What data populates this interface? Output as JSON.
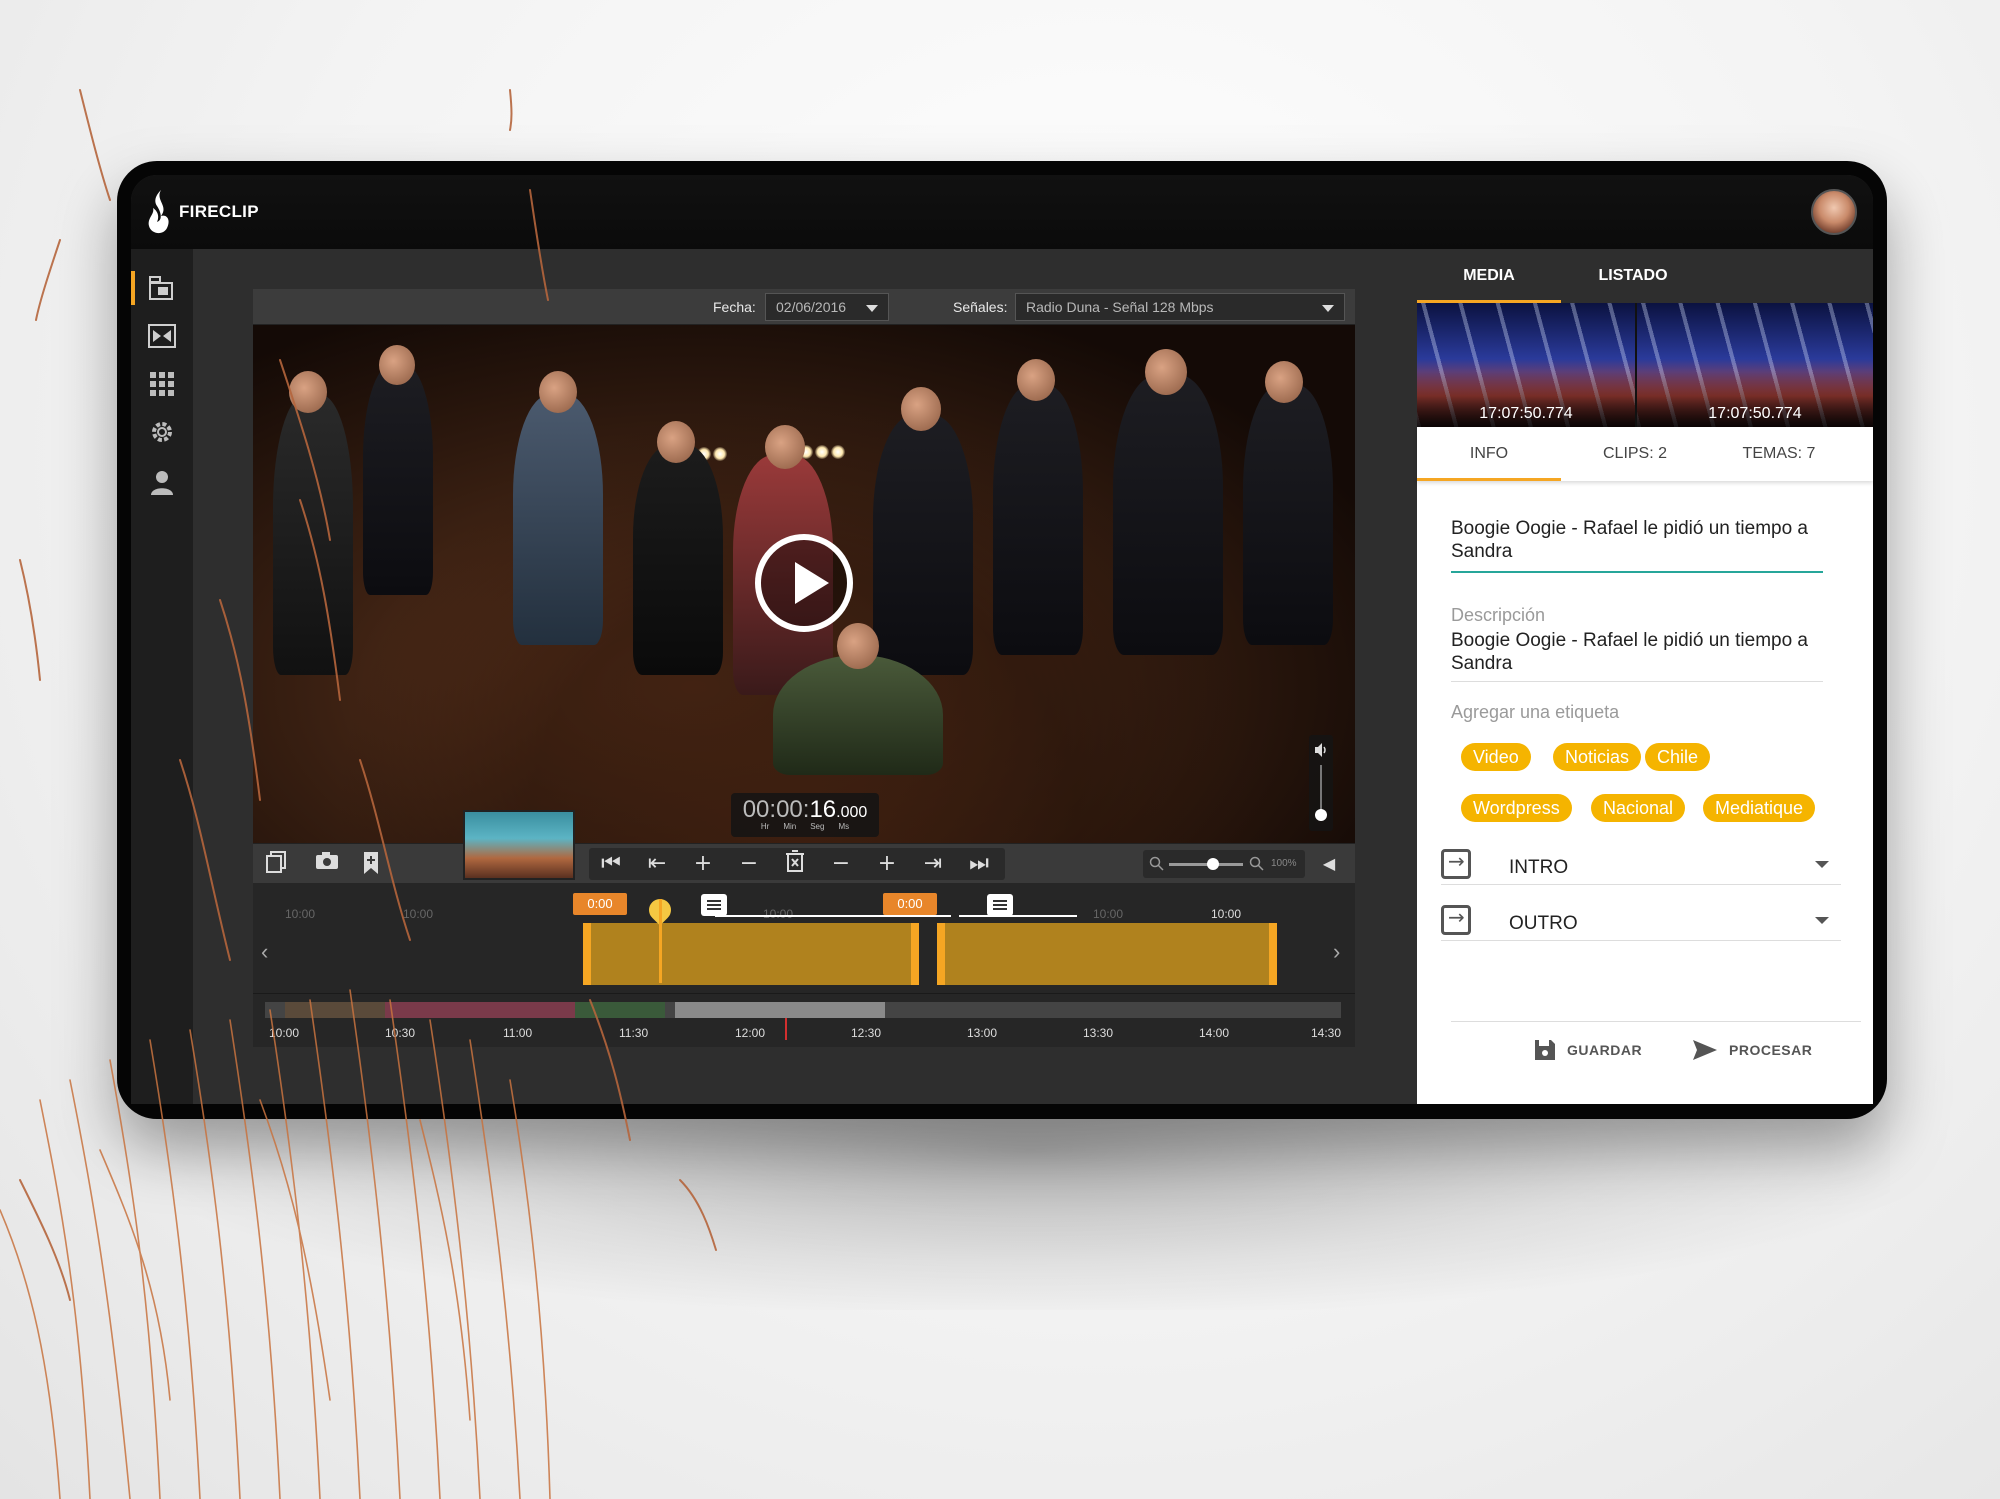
{
  "app": {
    "name": "FIRECLIP"
  },
  "sidebar": {
    "items": [
      {
        "name": "media",
        "icon": "film-icon",
        "active": true
      },
      {
        "name": "clips",
        "icon": "clip-icon",
        "active": false
      },
      {
        "name": "grid",
        "icon": "grid-icon",
        "active": false
      },
      {
        "name": "settings",
        "icon": "gear-icon",
        "active": false
      },
      {
        "name": "user",
        "icon": "user-icon",
        "active": false
      }
    ]
  },
  "player": {
    "fecha_label": "Fecha:",
    "fecha_value": "02/06/2016",
    "senales_label": "Señales:",
    "senales_value": "Radio Duna - Señal 128 Mbps",
    "timecode_prefix": "00:00:",
    "timecode_sec": "16",
    "timecode_ms": ".000",
    "units": [
      "Hr",
      "Min",
      "Seg",
      "Ms"
    ],
    "zoom": "100%"
  },
  "timeline": {
    "top_ticks": [
      "10:00",
      "10:00"
    ],
    "clips": [
      {
        "label": "0:00"
      },
      {
        "label": "0:00"
      }
    ],
    "overview_ticks": [
      "10:00",
      "10:30",
      "11:00",
      "11:30",
      "12:00",
      "12:30",
      "13:00",
      "13:30",
      "14:00",
      "14:30"
    ]
  },
  "panel": {
    "top_tabs": [
      "MEDIA",
      "LISTADO"
    ],
    "thumbnails": [
      "17:07:50.774",
      "17:07:50.774"
    ],
    "sub_tabs": [
      "INFO",
      "CLIPS: 2",
      "TEMAS: 7"
    ],
    "title_value": "Boogie Oogie - Rafael le pidió un tiempo a Sandra",
    "description_label": "Descripción",
    "description_value": "Boogie Oogie - Rafael le pidió un tiempo a Sandra",
    "tag_label": "Agregar una etiqueta",
    "tags": [
      "Video",
      "Noticias",
      "Chile",
      "Wordpress",
      "Nacional",
      "Mediatique"
    ],
    "intro_label": "INTRO",
    "outro_label": "OUTRO",
    "save_label": "GUARDAR",
    "process_label": "PROCESAR"
  },
  "colors": {
    "accent": "#f5a623",
    "chip": "#f5b400",
    "clip": "#b0821e",
    "focus": "#26a69a"
  }
}
